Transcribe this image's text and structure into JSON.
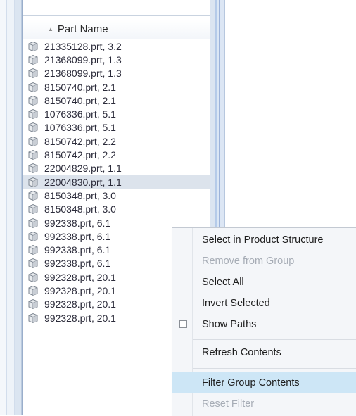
{
  "parts_list": {
    "column_header": "Part Name",
    "sort_indicator": "ascending",
    "icon": "part-file-icon",
    "rows": [
      {
        "label": "21335128.prt, 3.2"
      },
      {
        "label": "21368099.prt, 1.3"
      },
      {
        "label": "21368099.prt, 1.3"
      },
      {
        "label": "8150740.prt, 2.1"
      },
      {
        "label": "8150740.prt, 2.1"
      },
      {
        "label": "1076336.prt, 5.1"
      },
      {
        "label": "1076336.prt, 5.1"
      },
      {
        "label": "8150742.prt, 2.2"
      },
      {
        "label": "8150742.prt, 2.2"
      },
      {
        "label": "22004829.prt, 1.1"
      },
      {
        "label": "22004830.prt, 1.1",
        "selected": true
      },
      {
        "label": "8150348.prt, 3.0"
      },
      {
        "label": "8150348.prt, 3.0"
      },
      {
        "label": "992338.prt, 6.1"
      },
      {
        "label": "992338.prt, 6.1"
      },
      {
        "label": "992338.prt, 6.1"
      },
      {
        "label": "992338.prt, 6.1"
      },
      {
        "label": "992328.prt, 20.1"
      },
      {
        "label": "992328.prt, 20.1"
      },
      {
        "label": "992328.prt, 20.1"
      },
      {
        "label": "992328.prt, 20.1"
      }
    ]
  },
  "context_menu": {
    "items": [
      {
        "label": "Select in Product Structure",
        "enabled": true
      },
      {
        "label": "Remove from Group",
        "enabled": false
      },
      {
        "label": "Select All",
        "enabled": true
      },
      {
        "label": "Invert Selected",
        "enabled": true
      },
      {
        "label": "Show Paths",
        "enabled": true,
        "checkbox": true,
        "checked": false
      },
      {
        "label": "Refresh Contents",
        "enabled": true
      },
      {
        "label": "Filter Group Contents",
        "enabled": true,
        "highlighted": true
      },
      {
        "label": "Reset Filter",
        "enabled": false
      }
    ]
  },
  "colors": {
    "selection": "#dce3ec",
    "menu_highlight": "#cde6f6",
    "disabled_text": "#a7adb6"
  }
}
